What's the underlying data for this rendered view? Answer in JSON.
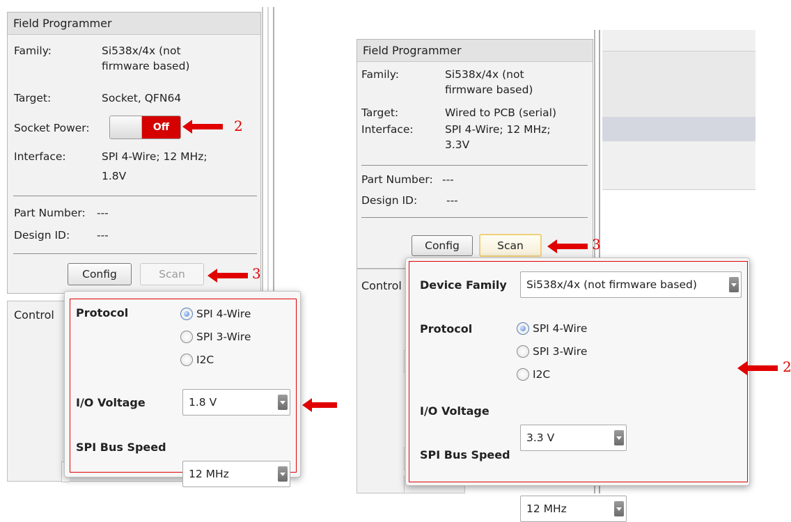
{
  "left": {
    "header": "Field Programmer",
    "family_label": "Family:",
    "family_value_line1": "Si538x/4x (not",
    "family_value_line2": "firmware based)",
    "target_label": "Target:",
    "target_value": "Socket, QFN64",
    "socket_power_label": "Socket Power:",
    "socket_power_state": "Off",
    "interface_label": "Interface:",
    "interface_line1": "SPI 4-Wire; 12 MHz;",
    "interface_line2": "1.8V",
    "part_number_label": "Part Number:",
    "part_number_value": "---",
    "design_id_label": "Design ID:",
    "design_id_value": "---",
    "config_button": "Config",
    "scan_button": "Scan",
    "control_label": "Control",
    "popup": {
      "protocol_label": "Protocol",
      "protocol_options": [
        "SPI 4-Wire",
        "SPI 3-Wire",
        "I2C"
      ],
      "protocol_selected": "SPI 4-Wire",
      "io_voltage_label": "I/O Voltage",
      "io_voltage_value": "1.8 V",
      "spi_speed_label": "SPI Bus Speed",
      "spi_speed_value": "12 MHz"
    },
    "annotations": {
      "socket_power_marker": "2",
      "scan_marker": "3"
    }
  },
  "right": {
    "header": "Field Programmer",
    "family_label": "Family:",
    "family_value_line1": "Si538x/4x (not",
    "family_value_line2": "firmware based)",
    "target_label": "Target:",
    "target_value": "Wired to PCB (serial)",
    "interface_label": "Interface:",
    "interface_line1": "SPI 4-Wire; 12 MHz;",
    "interface_line2": "3.3V",
    "part_number_label": "Part Number:",
    "part_number_value": "---",
    "design_id_label": "Design ID:",
    "design_id_value": "---",
    "config_button": "Config",
    "scan_button": "Scan",
    "control_label": "Control",
    "popup": {
      "device_family_label": "Device Family",
      "device_family_value": "Si538x/4x (not firmware based)",
      "protocol_label": "Protocol",
      "protocol_options": [
        "SPI 4-Wire",
        "SPI 3-Wire",
        "I2C"
      ],
      "protocol_selected": "SPI 4-Wire",
      "io_voltage_label": "I/O Voltage",
      "io_voltage_value": "3.3 V",
      "spi_speed_label": "SPI Bus Speed",
      "spi_speed_value": "12 MHz"
    },
    "annotations": {
      "scan_marker": "3",
      "popup_marker": "2"
    }
  },
  "colors": {
    "accent_red": "#e00000",
    "toggle_off": "#d50000"
  }
}
